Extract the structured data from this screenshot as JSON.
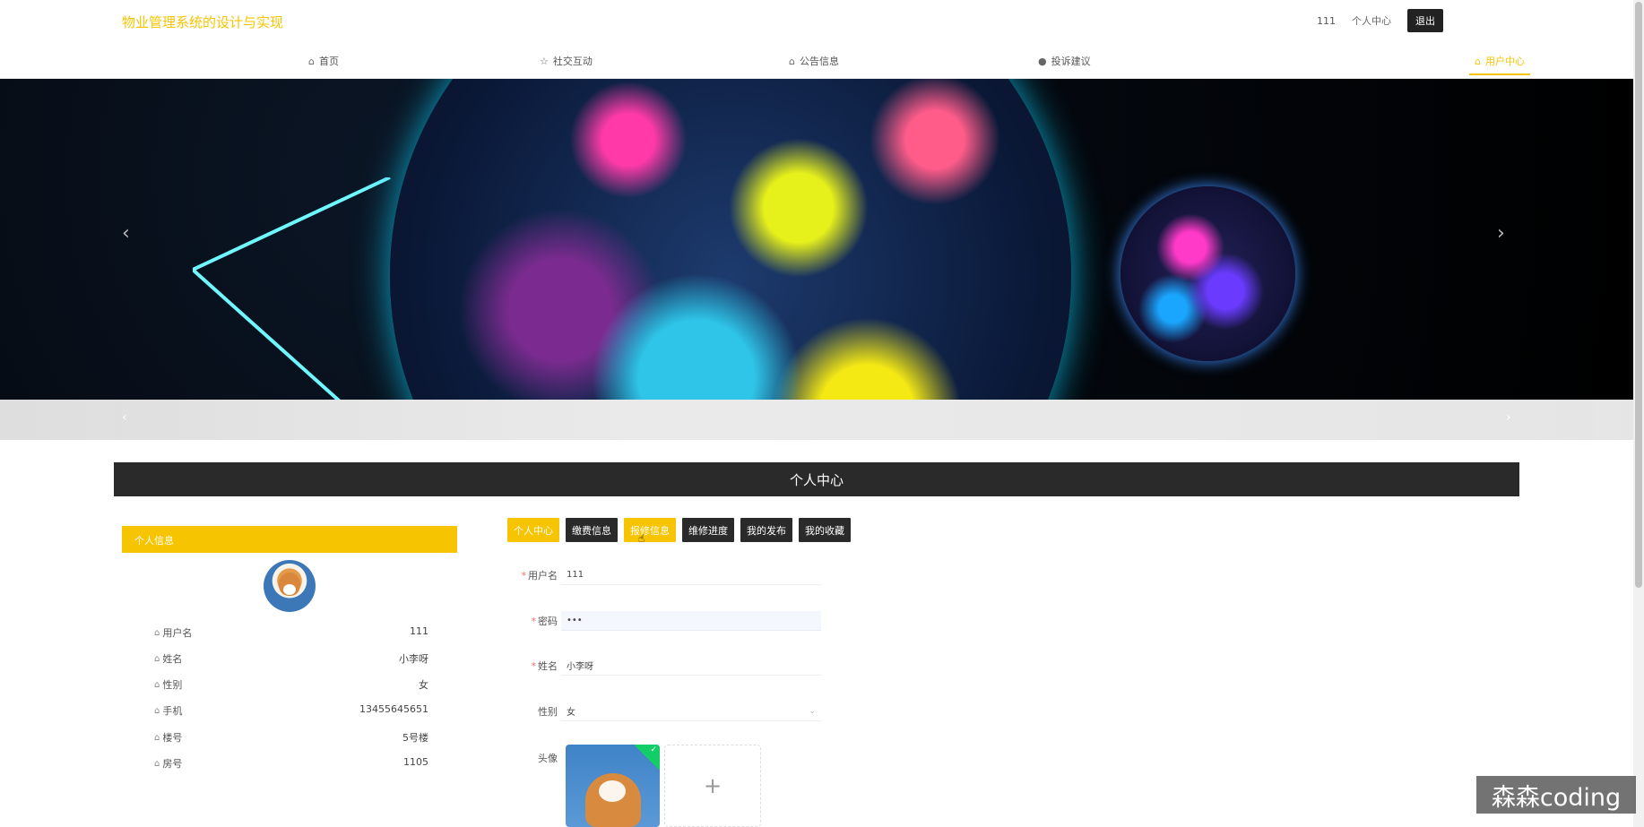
{
  "app": {
    "title": "物业管理系统的设计与实现"
  },
  "topbar": {
    "username": "111",
    "profile_link": "个人中心",
    "logout_button": "退出"
  },
  "nav": {
    "items": [
      {
        "label": "首页",
        "icon": "home-icon"
      },
      {
        "label": "社交互动",
        "icon": "star-icon"
      },
      {
        "label": "公告信息",
        "icon": "bag-icon"
      },
      {
        "label": "投诉建议",
        "icon": "info-icon"
      },
      {
        "label": "用户中心",
        "icon": "home-icon",
        "active": true
      }
    ]
  },
  "banner": {
    "prev": "‹",
    "next": "›"
  },
  "section": {
    "title": "个人中心"
  },
  "profile": {
    "header": "个人信息",
    "fields": [
      {
        "label": "用户名",
        "value": "111"
      },
      {
        "label": "姓名",
        "value": "小李呀"
      },
      {
        "label": "性别",
        "value": "女"
      },
      {
        "label": "手机",
        "value": "13455645651"
      },
      {
        "label": "楼号",
        "value": "5号楼"
      },
      {
        "label": "房号",
        "value": "1105"
      }
    ]
  },
  "tabs": [
    {
      "label": "个人中心",
      "active": true
    },
    {
      "label": "缴费信息"
    },
    {
      "label": "报修信息",
      "hover": true
    },
    {
      "label": "维修进度"
    },
    {
      "label": "我的发布"
    },
    {
      "label": "我的收藏"
    }
  ],
  "form": {
    "username": {
      "label": "用户名",
      "value": "111",
      "required": true
    },
    "password": {
      "label": "密码",
      "value": "•••",
      "required": true
    },
    "name": {
      "label": "姓名",
      "value": "小李呀",
      "required": true
    },
    "gender": {
      "label": "性别",
      "value": "女"
    },
    "avatar": {
      "label": "头像"
    }
  },
  "watermark": "森森coding",
  "colors": {
    "accent": "#f6c400",
    "dark": "#2a2a2a",
    "success": "#13ce66"
  }
}
